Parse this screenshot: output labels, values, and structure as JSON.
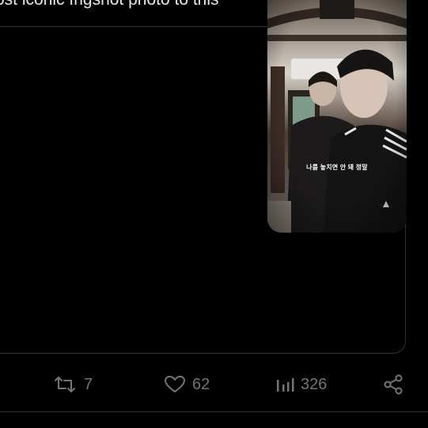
{
  "tweet": {
    "text": "ost iconic fngshot photo to this"
  },
  "media": {
    "subtitle": "나를 놓치면 안 돼 정말"
  },
  "actions": {
    "retweet_count": "7",
    "like_count": "62",
    "views_count": "326"
  },
  "icons": {
    "retweet": "retweet-icon",
    "like": "heart-icon",
    "views": "views-icon",
    "share": "share-icon"
  },
  "colors": {
    "background": "#000000",
    "text": "#e7e9ea",
    "muted": "#71767b",
    "divider": "#2f3336"
  }
}
